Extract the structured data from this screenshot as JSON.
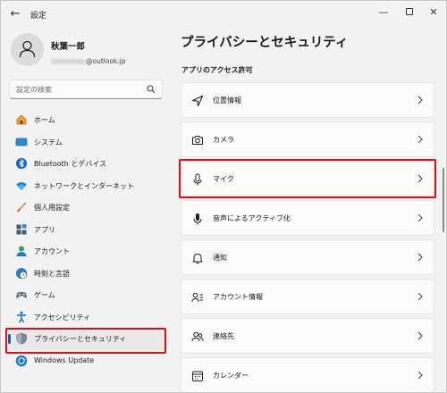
{
  "window": {
    "title": "設定"
  },
  "profile": {
    "name": "秋葉一郎",
    "email_suffix": "@outlook.jp"
  },
  "search": {
    "placeholder": "設定の検索"
  },
  "sidebar": {
    "items": [
      {
        "label": "ホーム",
        "icon": "home-icon"
      },
      {
        "label": "システム",
        "icon": "system-icon"
      },
      {
        "label": "Bluetooth とデバイス",
        "icon": "bluetooth-icon"
      },
      {
        "label": "ネットワークとインターネット",
        "icon": "wifi-icon"
      },
      {
        "label": "個人用設定",
        "icon": "brush-icon"
      },
      {
        "label": "アプリ",
        "icon": "apps-icon"
      },
      {
        "label": "アカウント",
        "icon": "account-icon"
      },
      {
        "label": "時刻と言語",
        "icon": "time-language-icon"
      },
      {
        "label": "ゲーム",
        "icon": "gamepad-icon"
      },
      {
        "label": "アクセシビリティ",
        "icon": "accessibility-icon"
      },
      {
        "label": "プライバシーとセキュリティ",
        "icon": "shield-icon",
        "selected": true
      },
      {
        "label": "Windows Update",
        "icon": "windows-update-icon"
      }
    ]
  },
  "main": {
    "title": "プライバシーとセキュリティ",
    "section": "アプリのアクセス許可",
    "cards": [
      {
        "label": "位置情報",
        "icon": "location-icon"
      },
      {
        "label": "カメラ",
        "icon": "camera-icon"
      },
      {
        "label": "マイク",
        "icon": "microphone-icon"
      },
      {
        "label": "音声によるアクティブ化",
        "icon": "voice-activation-icon"
      },
      {
        "label": "通知",
        "icon": "bell-icon"
      },
      {
        "label": "アカウント情報",
        "icon": "account-info-icon"
      },
      {
        "label": "連絡先",
        "icon": "contacts-icon"
      },
      {
        "label": "カレンダー",
        "icon": "calendar-icon"
      }
    ]
  },
  "colors": {
    "accent": "#0067c0",
    "highlight": "#e01010",
    "background": "#f3f3f3",
    "card": "#fbfbfb"
  }
}
